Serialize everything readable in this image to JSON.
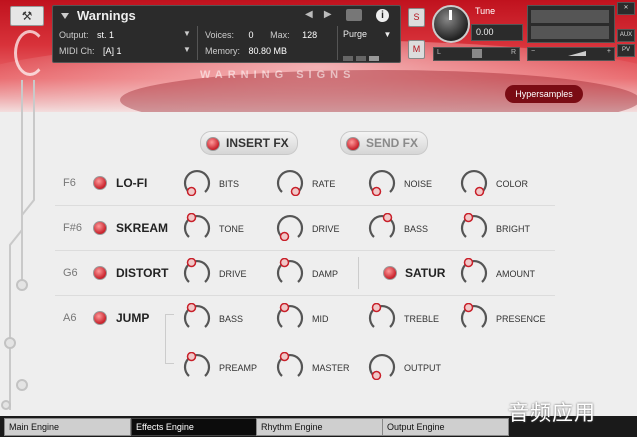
{
  "instrument": {
    "name": "Warnings",
    "output_label": "Output:",
    "output_value": "st. 1",
    "voices_label": "Voices:",
    "voices_value": "0",
    "max_label": "Max:",
    "max_value": "128",
    "midi_label": "MIDI Ch:",
    "midi_value": "[A]  1",
    "memory_label": "Memory:",
    "memory_value": "80.80 MB",
    "purge_label": "Purge",
    "nav_prev": "◀",
    "nav_next": "▶",
    "info_label": "i"
  },
  "controls": {
    "solo": "S",
    "mute": "M",
    "tune_label": "Tune",
    "tune_value": "0.00",
    "pan_left": "L",
    "pan_right": "R",
    "aux": "AUX",
    "pv": "PV",
    "close": "✕",
    "vol_minus": "−",
    "vol_plus": "+"
  },
  "branding": {
    "logo_text": "WARNING SIGNS",
    "maker": "Hypersamples"
  },
  "fx_buttons": {
    "insert": "INSERT FX",
    "send": "SEND FX"
  },
  "effects": [
    {
      "note": "F6",
      "name": "LO-FI",
      "params": [
        "BITS",
        "RATE",
        "NOISE",
        "COLOR"
      ]
    },
    {
      "note": "F#6",
      "name": "SKREAM",
      "params": [
        "TONE",
        "DRIVE",
        "BASS",
        "BRIGHT"
      ]
    },
    {
      "note": "G6",
      "name": "DISTORT",
      "params": [
        "DRIVE",
        "DAMP"
      ],
      "extra_name": "SATUR",
      "extra_params": [
        "AMOUNT"
      ]
    },
    {
      "note": "A6",
      "name": "JUMP",
      "params": [
        "BASS",
        "MID",
        "TREBLE",
        "PRESENCE",
        "PREAMP",
        "MASTER",
        "OUTPUT"
      ]
    }
  ],
  "tabs": [
    "Main Engine",
    "Effects Engine",
    "Rhythm Engine",
    "Output Engine"
  ],
  "active_tab": "Effects Engine",
  "watermark": "音频应用",
  "colors": {
    "accent": "#c8202a",
    "header": "#c0121e",
    "panel": "#2b2b2b"
  },
  "icons": [
    "wrench-icon",
    "camera-icon",
    "info-icon",
    "led-icon",
    "knob-icon"
  ]
}
